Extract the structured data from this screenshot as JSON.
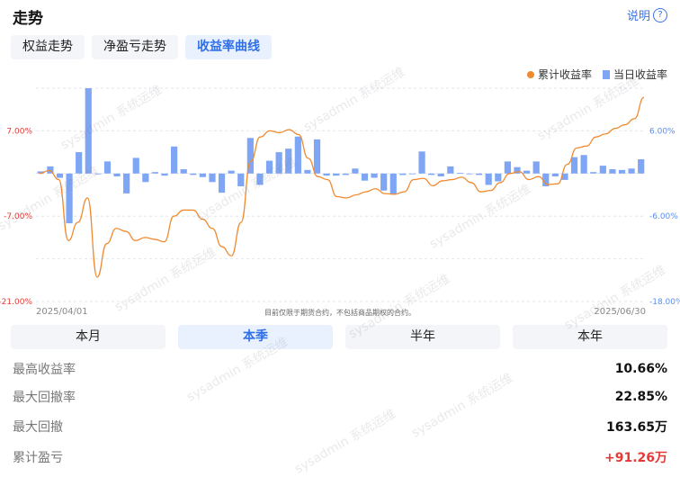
{
  "header": {
    "title": "走势",
    "help_label": "说明",
    "help_icon": "question-circle-icon"
  },
  "tabs": [
    {
      "label": "权益走势",
      "active": false
    },
    {
      "label": "净盈亏走势",
      "active": false
    },
    {
      "label": "收益率曲线",
      "active": true
    }
  ],
  "legend": {
    "cumulative": "累计收益率",
    "daily": "当日收益率"
  },
  "note": "目前仅限于期货合约，不包括商品期权的合约。",
  "periods": [
    {
      "label": "本月",
      "active": false
    },
    {
      "label": "本季",
      "active": true
    },
    {
      "label": "半年",
      "active": false
    },
    {
      "label": "本年",
      "active": false
    }
  ],
  "stats": [
    {
      "label": "最高收益率",
      "value": "10.66%",
      "positive": false
    },
    {
      "label": "最大回撤率",
      "value": "22.85%",
      "positive": false
    },
    {
      "label": "最大回撤",
      "value": "163.65万",
      "positive": false
    },
    {
      "label": "累计盈亏",
      "value": "+91.26万",
      "positive": true
    }
  ],
  "watermark": "sysadmin 系统运维",
  "chart_data": {
    "type": "bar+line",
    "colors": {
      "line": "#f08a30",
      "bar": "#7ea6f5",
      "grid": "#e3e6ec",
      "left_axis": "#e53935",
      "right_axis": "#5b8ef0",
      "x_axis": "#888888"
    },
    "x_start_label": "2025/04/01",
    "x_end_label": "2025/06/30",
    "left_axis": {
      "name": "累计收益率",
      "range": [
        -21,
        14
      ],
      "ticks": [
        "7.00%",
        "-7.00%",
        "-21.00%"
      ],
      "tick_values": [
        7,
        -7,
        -21
      ]
    },
    "right_axis": {
      "name": "当日收益率",
      "range": [
        -18,
        12
      ],
      "ticks": [
        "6.00%",
        "-6.00%",
        "-18.00%"
      ],
      "tick_values": [
        6,
        -6,
        -18
      ]
    },
    "series": [
      {
        "name": "当日收益率",
        "type": "bar",
        "values": [
          0.3,
          1.0,
          -0.6,
          -7.0,
          3.0,
          12.0,
          0.0,
          1.7,
          -0.4,
          -2.8,
          2.2,
          -1.2,
          0.2,
          -0.3,
          3.8,
          0.6,
          -0.2,
          -0.5,
          -1.2,
          -2.7,
          0.4,
          -1.8,
          5.0,
          -1.6,
          1.8,
          3.0,
          3.5,
          5.2,
          0.5,
          4.8,
          -0.3,
          -0.3,
          -0.2,
          0.7,
          -1.0,
          -0.6,
          -2.4,
          -2.9,
          -0.2,
          0.0,
          3.1,
          -0.2,
          -0.4,
          1.0,
          0.1,
          0.0,
          -0.2,
          -1.6,
          -1.1,
          1.7,
          0.9,
          0.4,
          1.7,
          -1.8,
          -0.4,
          -0.9,
          2.3,
          2.6,
          0.2,
          1.1,
          0.6,
          0.5,
          0.7,
          2.0
        ]
      },
      {
        "name": "累计收益率",
        "type": "line",
        "values": [
          0.0,
          0.5,
          -1.0,
          -11.0,
          -8.0,
          -4.0,
          -17.0,
          -11.5,
          -9.0,
          -9.5,
          -11.0,
          -10.5,
          -10.8,
          -11.2,
          -7.0,
          -6.0,
          -6.0,
          -7.5,
          -9.0,
          -12.0,
          -13.5,
          -8.0,
          2.0,
          6.0,
          7.0,
          6.7,
          7.2,
          6.4,
          2.5,
          -0.5,
          -1.0,
          -3.8,
          -4.0,
          -3.5,
          -3.0,
          -2.5,
          -3.3,
          -3.4,
          -3.0,
          -1.0,
          -0.8,
          -2.0,
          -1.2,
          -1.0,
          -0.6,
          -1.5,
          -3.0,
          -2.8,
          -1.5,
          0.0,
          0.3,
          -1.0,
          -0.5,
          -1.8,
          -1.7,
          1.5,
          4.2,
          4.5,
          6.0,
          6.5,
          7.4,
          8.0,
          9.0,
          12.5
        ]
      }
    ]
  }
}
